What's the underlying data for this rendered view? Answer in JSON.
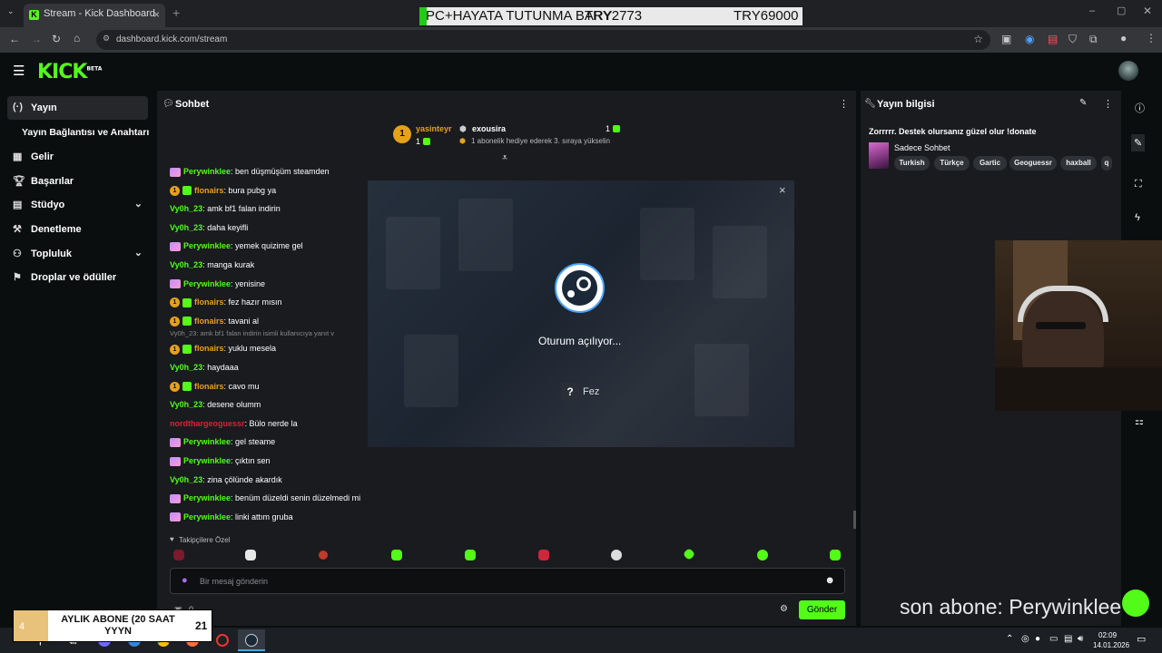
{
  "browser": {
    "tab_title": "Stream - Kick Dashboard",
    "url": "dashboard.kick.com/stream",
    "overlay_left": "PC+HAYATA TUTUNMA BARY",
    "overlay_mid": "TRY2773",
    "overlay_right": "TRY69000"
  },
  "sidebar": {
    "items": [
      {
        "label": "Yayın",
        "icon": "broadcast-icon",
        "active": true
      },
      {
        "label": "Yayın Bağlantısı ve Anahtarı",
        "icon": "",
        "active": false
      },
      {
        "label": "Gelir",
        "icon": "revenue-icon",
        "active": false
      },
      {
        "label": "Başarılar",
        "icon": "trophy-icon",
        "active": false
      },
      {
        "label": "Stüdyo",
        "icon": "studio-icon",
        "active": false,
        "expandable": true
      },
      {
        "label": "Denetleme",
        "icon": "moderation-icon",
        "active": false
      },
      {
        "label": "Topluluk",
        "icon": "community-icon",
        "active": false,
        "expandable": true
      },
      {
        "label": "Droplar ve ödüller",
        "icon": "drops-icon",
        "active": false
      }
    ]
  },
  "chat": {
    "title": "Sohbet",
    "pinned": {
      "gifter_name": "yasinteyr",
      "gifter_count": "1",
      "gifter_rank": "1",
      "top_name": "exousira",
      "top_count": "1",
      "top_message": "1 abonelik hediye ederek 3. sıraya yükselin"
    },
    "messages": [
      {
        "user": "Perywinklee",
        "text": "ben düşmüşüm steamden",
        "color": "#53fc18",
        "badges": [
          "p"
        ]
      },
      {
        "user": "flonairs",
        "text": "bura pubg ya",
        "color": "#e6a11a",
        "badges": [
          "1",
          "g"
        ]
      },
      {
        "user": "Vy0h_23",
        "text": "amk bf1 falan indirin",
        "color": "#53fc18",
        "badges": []
      },
      {
        "user": "Vy0h_23",
        "text": "daha keyifli",
        "color": "#53fc18",
        "badges": []
      },
      {
        "user": "Perywinklee",
        "text": "yemek quizime gel",
        "color": "#53fc18",
        "badges": [
          "p"
        ]
      },
      {
        "user": "Vy0h_23",
        "text": "manga kurak",
        "color": "#53fc18",
        "badges": []
      },
      {
        "user": "Perywinklee",
        "text": "yenisine",
        "color": "#53fc18",
        "badges": [
          "p"
        ]
      },
      {
        "user": "flonairs",
        "text": "fez hazır mısın",
        "color": "#e6a11a",
        "badges": [
          "1",
          "g"
        ]
      },
      {
        "user": "flonairs",
        "text": "tavani al",
        "color": "#e6a11a",
        "badges": [
          "1",
          "g"
        ]
      },
      {
        "user": "flonairs",
        "text": "yuklu mesela",
        "color": "#e6a11a",
        "badges": [
          "1",
          "g"
        ],
        "reply": "Vy0h_23: amk bf1 falan indirin isimli kullanıcıya yanıt v"
      },
      {
        "user": "Vy0h_23",
        "text": "haydaaa",
        "color": "#53fc18",
        "badges": []
      },
      {
        "user": "flonairs",
        "text": "cavo mu",
        "color": "#e6a11a",
        "badges": [
          "1",
          "g"
        ]
      },
      {
        "user": "Vy0h_23",
        "text": "desene olumm",
        "color": "#53fc18",
        "badges": []
      },
      {
        "user": "nordthargeoguessr",
        "text": "Bülo nerde la",
        "color": "#e01e37",
        "badges": []
      },
      {
        "user": "Perywinklee",
        "text": "gel steame",
        "color": "#53fc18",
        "badges": [
          "p"
        ]
      },
      {
        "user": "Perywinklee",
        "text": "çıktın sen",
        "color": "#53fc18",
        "badges": [
          "p"
        ]
      },
      {
        "user": "Vy0h_23",
        "text": "zina çölünde akardık",
        "color": "#53fc18",
        "badges": []
      },
      {
        "user": "Perywinklee",
        "text": "benüm düzeldi senin düzelmedi mi",
        "color": "#53fc18",
        "badges": [
          "p"
        ]
      },
      {
        "user": "Perywinklee",
        "text": "linki attım gruba",
        "color": "#53fc18",
        "badges": [
          "p"
        ]
      }
    ],
    "followers_only": "Takipçilere Özel",
    "input_placeholder": "Bir mesaj gönderin",
    "send_label": "Gönder",
    "count_value": "0"
  },
  "modal": {
    "status": "Oturum açılıyor...",
    "account": "Fez",
    "help_glyph": "?"
  },
  "info": {
    "title": "Yayın bilgisi",
    "stream_title": "Zorrrrr. Destek olursanız güzel olur !donate",
    "category": "Sadece Sohbet",
    "tags": [
      "Turkish",
      "Türkçe",
      "Gartic",
      "Geoguessr",
      "haxball",
      "q"
    ]
  },
  "overlays": {
    "sub_count": "4",
    "sub_goal_text": "AYLIK ABONE (20 SAAT YYYN",
    "sub_goal_value": "21",
    "last_sub": "son abone: Perywinklee"
  },
  "taskbar": {
    "time": "02:09",
    "date": "14.01.2026"
  }
}
